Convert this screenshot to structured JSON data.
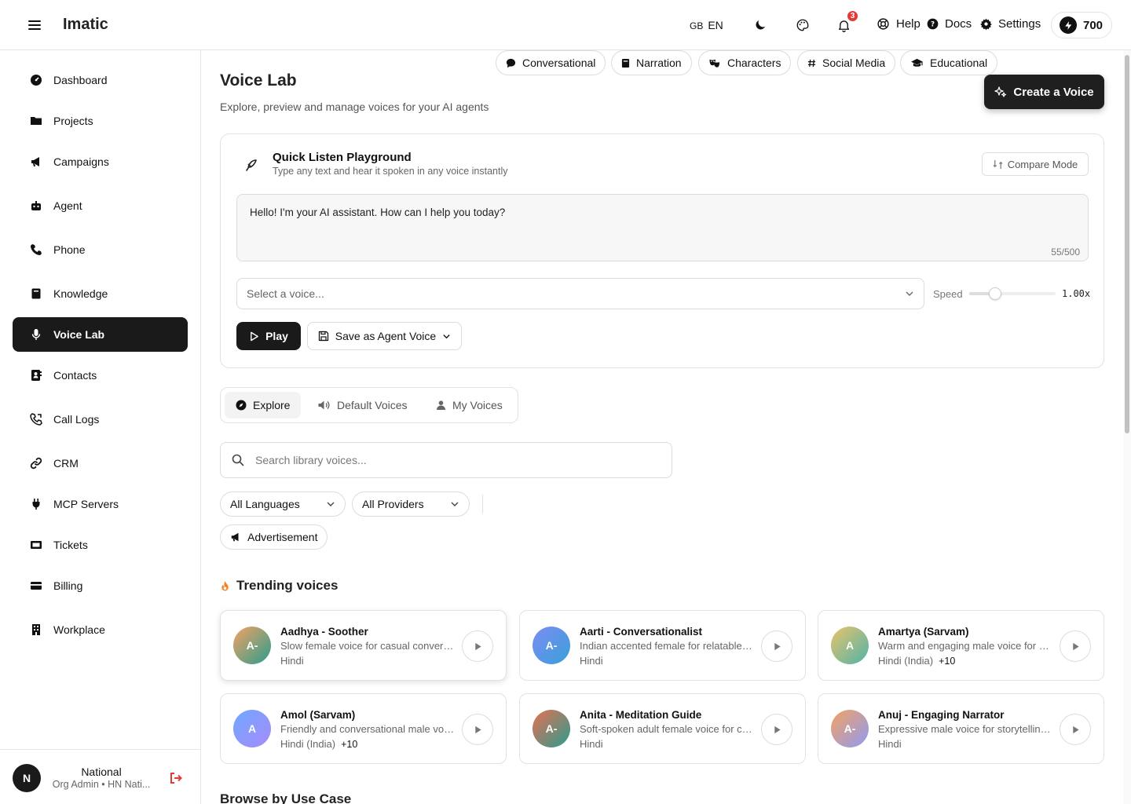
{
  "topbar": {
    "brand": "Imatic",
    "lang_flag": "GB",
    "lang_code": "EN",
    "notification_count": "3",
    "help": "Help",
    "docs": "Docs",
    "settings": "Settings",
    "credits": "700"
  },
  "sidebar": {
    "items": [
      {
        "label": "Dashboard",
        "icon": "dashboard-icon"
      },
      {
        "label": "Projects",
        "icon": "folder-icon"
      },
      {
        "label": "Campaigns",
        "icon": "megaphone-icon"
      },
      {
        "label": "Agent",
        "icon": "robot-icon"
      },
      {
        "label": "Phone",
        "icon": "phone-icon"
      },
      {
        "label": "Knowledge",
        "icon": "book-icon"
      },
      {
        "label": "Voice Lab",
        "icon": "microphone-icon"
      },
      {
        "label": "Contacts",
        "icon": "contacts-icon"
      },
      {
        "label": "Call Logs",
        "icon": "phone-log-icon"
      },
      {
        "label": "CRM",
        "icon": "link-icon"
      },
      {
        "label": "MCP Servers",
        "icon": "plug-icon"
      },
      {
        "label": "Tickets",
        "icon": "ticket-icon"
      },
      {
        "label": "Billing",
        "icon": "card-icon"
      },
      {
        "label": "Workplace",
        "icon": "building-icon"
      }
    ],
    "user": {
      "initial": "N",
      "name": "National",
      "role": "Org Admin • HN Nati..."
    }
  },
  "page": {
    "title": "Voice Lab",
    "subtitle": "Explore, preview and manage voices for your AI agents",
    "create_button": "Create a Voice"
  },
  "playground": {
    "title": "Quick Listen Playground",
    "subtitle": "Type any text and hear it spoken in any voice instantly",
    "compare_button": "Compare Mode",
    "text": "Hello! I'm your AI assistant. How can I help you today?",
    "char_count": "55/500",
    "voice_placeholder": "Select a voice...",
    "speed_label": "Speed",
    "speed_value": "1.00x",
    "speed_fraction": 0.3,
    "play_button": "Play",
    "save_button": "Save as Agent Voice"
  },
  "tabs": [
    {
      "label": "Explore",
      "icon": "compass-icon"
    },
    {
      "label": "Default Voices",
      "icon": "speaker-icon"
    },
    {
      "label": "My Voices",
      "icon": "user-icon"
    }
  ],
  "search": {
    "placeholder": "Search library voices..."
  },
  "filters": {
    "languages": "All Languages",
    "providers": "All Providers",
    "chips": [
      {
        "label": "Conversational",
        "icon": "chat-icon"
      },
      {
        "label": "Narration",
        "icon": "book-icon"
      },
      {
        "label": "Characters",
        "icon": "masks-icon"
      },
      {
        "label": "Social Media",
        "icon": "hashtag-icon"
      },
      {
        "label": "Educational",
        "icon": "graduation-cap-icon"
      },
      {
        "label": "Advertisement",
        "icon": "megaphone-icon"
      }
    ]
  },
  "trending": {
    "title": "Trending voices",
    "voices": [
      {
        "initials": "A-",
        "name": "Aadhya - Soother",
        "desc": "Slow female voice for casual conversations and relaxed reading",
        "lang": "Hindi",
        "more": "",
        "grad": [
          "#f4a261",
          "#2a9d8f"
        ]
      },
      {
        "initials": "A-",
        "name": "Aarti - Conversationalist",
        "desc": "Indian accented female for relatable conversations",
        "lang": "Hindi",
        "more": "",
        "grad": [
          "#7b8cf5",
          "#3aa0d8"
        ]
      },
      {
        "initials": "A",
        "name": "Amartya (Sarvam)",
        "desc": "Warm and engaging male voice for storytelling",
        "lang": "Hindi (India)",
        "more": "+10",
        "grad": [
          "#e9c46a",
          "#4fb3a9"
        ]
      },
      {
        "initials": "A",
        "name": "Amol (Sarvam)",
        "desc": "Friendly and conversational male voice for support",
        "lang": "Hindi (India)",
        "more": "+10",
        "grad": [
          "#6fa8ff",
          "#a78bfa"
        ]
      },
      {
        "initials": "A-",
        "name": "Anita - Meditation Guide",
        "desc": "Soft-spoken adult female voice for calm meditation",
        "lang": "Hindi",
        "more": "",
        "grad": [
          "#e76f51",
          "#2a9d8f"
        ]
      },
      {
        "initials": "A-",
        "name": "Anuj - Engaging Narrator",
        "desc": "Expressive male voice for storytelling and narration",
        "lang": "Hindi",
        "more": "",
        "grad": [
          "#f4a261",
          "#8e9af5"
        ]
      }
    ]
  },
  "browse_title": "Browse by Use Case"
}
